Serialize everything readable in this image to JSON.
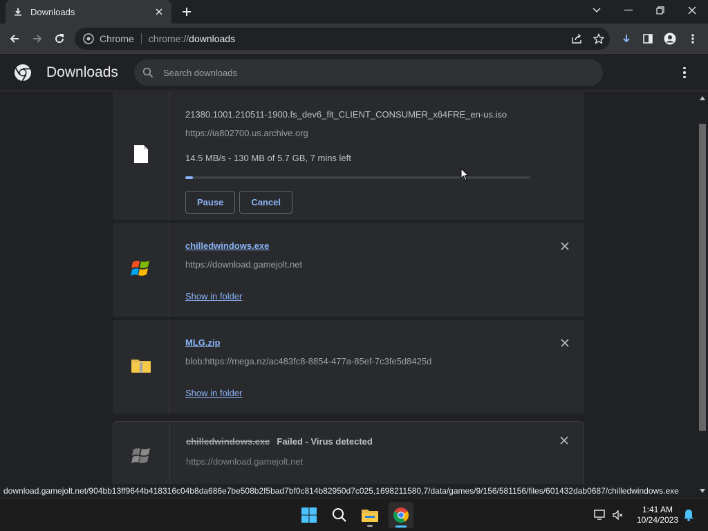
{
  "tab": {
    "title": "Downloads"
  },
  "omnibox": {
    "site_label": "Chrome",
    "url_scheme": "chrome://",
    "url_host": "downloads"
  },
  "header": {
    "title": "Downloads",
    "search_placeholder": "Search downloads"
  },
  "downloads": [
    {
      "filename": "21380.1001.210511-1900.fs_dev6_flt_CLIENT_CONSUMER_x64FRE_en-us.iso",
      "source": "https://ia802700.us.archive.org",
      "progress_text": "14.5 MB/s - 130 MB of 5.7 GB, 7 mins left",
      "progress_fraction": 0.0228,
      "pause_label": "Pause",
      "cancel_label": "Cancel"
    },
    {
      "filename": "chilledwindows.exe",
      "source": "https://download.gamejolt.net",
      "action_label": "Show in folder"
    },
    {
      "filename": "MLG.zip",
      "source": "blob:https://mega.nz/ac483fc8-8854-477a-85ef-7c3fe5d8425d",
      "action_label": "Show in folder"
    },
    {
      "filename": "chilledwindows.exe",
      "status": "Failed - Virus detected",
      "source": "https://download.gamejolt.net"
    }
  ],
  "status_url": "download.gamejolt.net/904bb13ff9644b418316c04b8da686e7be508b2f5bad7bf0c814b82950d7c025,1698211580,7/data/games/9/156/581156/files/601432dab0687/chilledwindows.exe",
  "tray": {
    "time": "1:41 AM",
    "date": "10/24/2023"
  },
  "colors": {
    "accent": "#8ab4f8",
    "background": "#202124",
    "card": "#292a2d"
  }
}
